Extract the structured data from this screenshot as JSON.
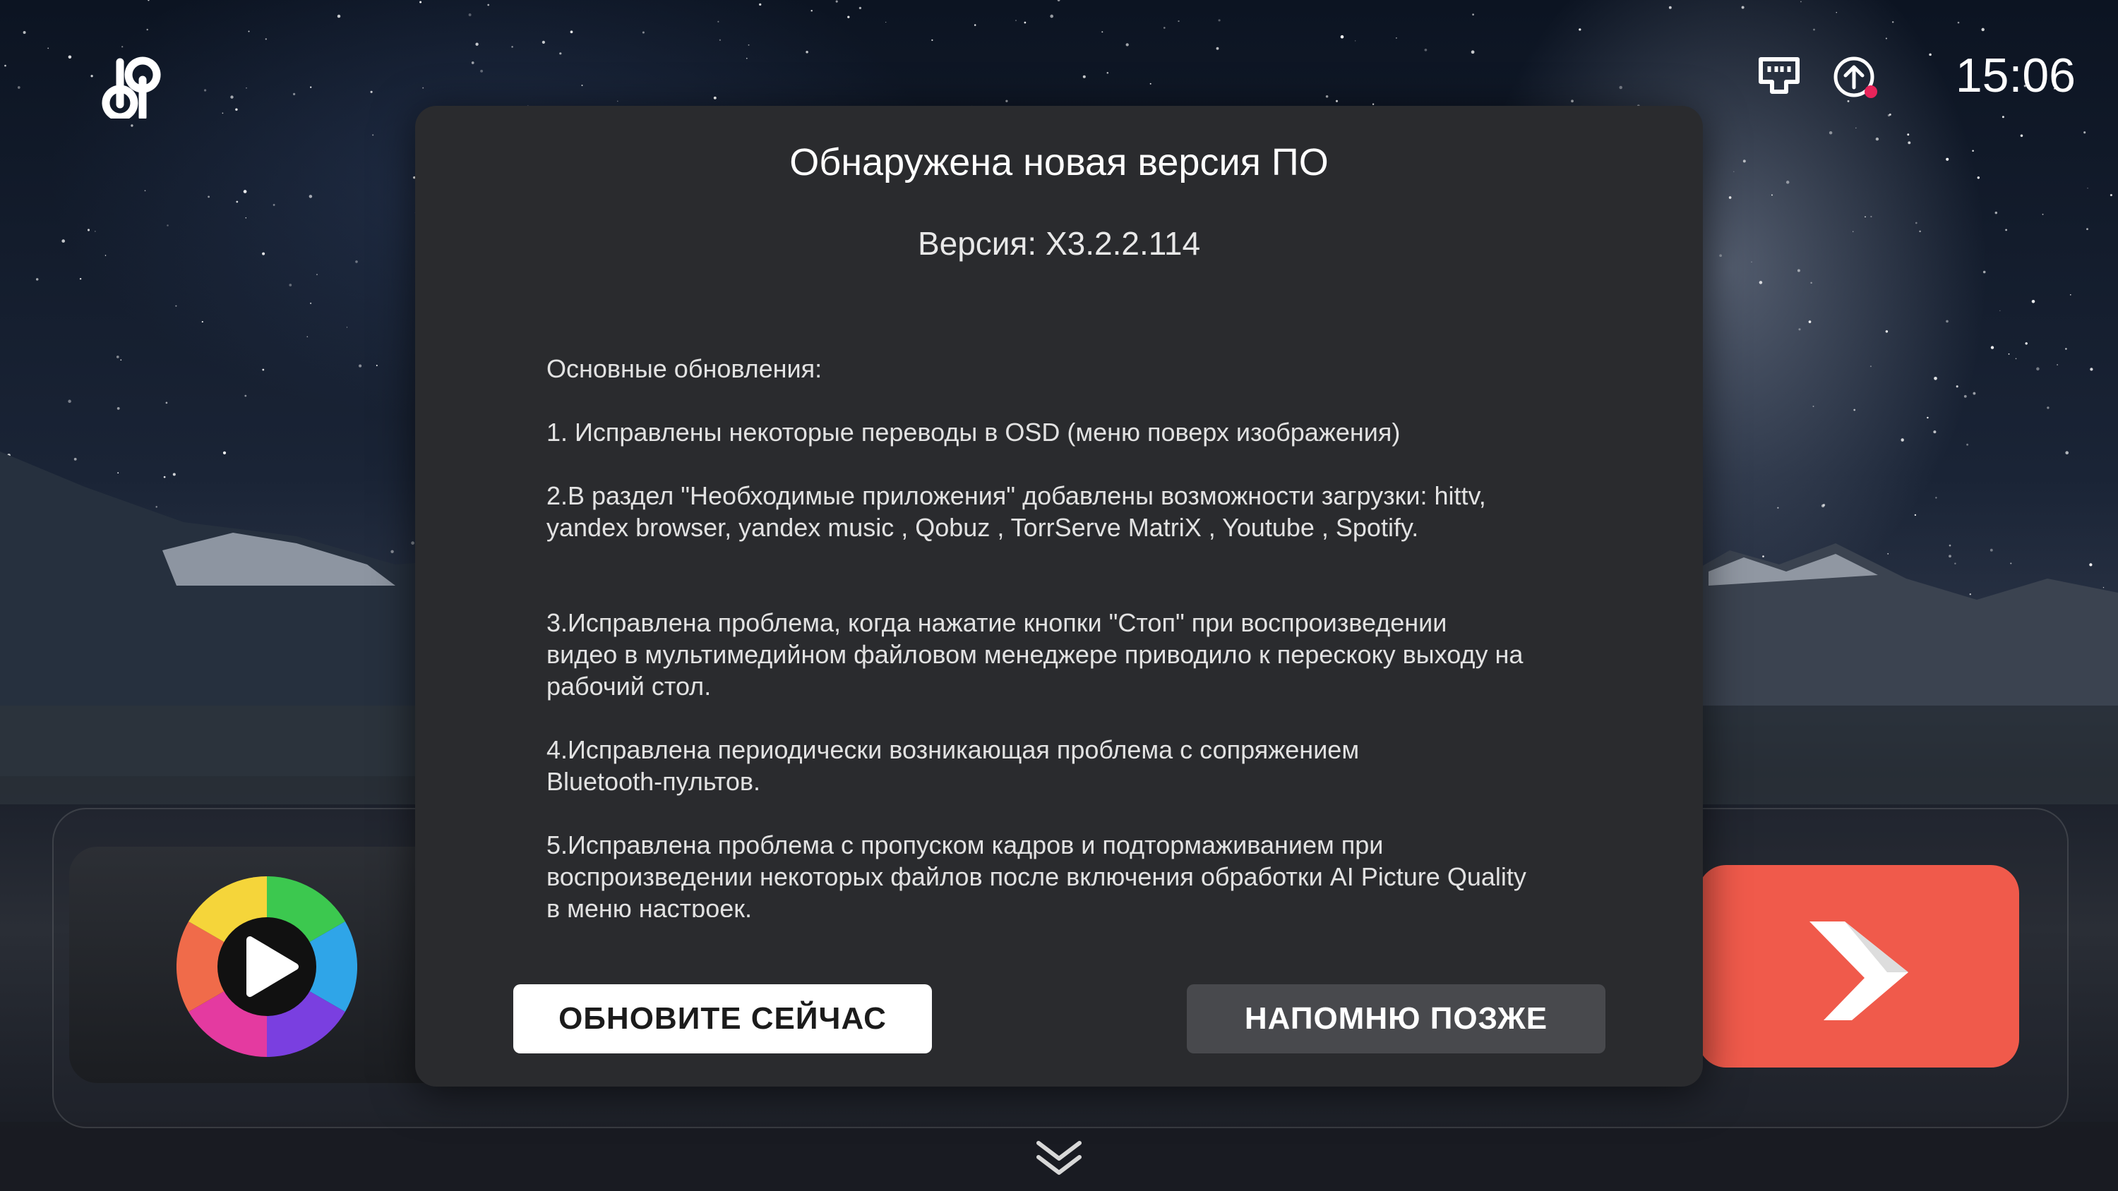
{
  "status_bar": {
    "time": "15:06",
    "logo": "dp-logo",
    "icons": [
      "ethernet-icon",
      "update-available-icon"
    ],
    "notification_dot_color": "#e8245a"
  },
  "dialog": {
    "title": "Обнаружена новая версия ПО",
    "version": "Версия: X3.2.2.114",
    "notes": [
      "Основные обновления:",
      "1. Исправлены некоторые переводы в OSD (меню поверх изображения)",
      "2.В раздел \"Необходимые приложения\" добавлены возможности загрузки: hittv,\nyandex browser, yandex music , Qobuz , TorrServe MatriX , Youtube , Spotify.",
      "3.Исправлена проблема, когда нажатие кнопки \"Стоп\" при воспроизведении\nвидео в мультимедийном файловом менеджере приводило к перескоку выходу на\nрабочий стол.",
      "4.Исправлена периодически возникающая проблема с сопряжением\nBluetooth-пультов.",
      "5.Исправлена проблема с пропуском кадров и подтормаживанием при\nвоспроизведении некоторых файлов после включения обработки AI Picture Quality\nв меню настроек."
    ],
    "buttons": {
      "update_now": "ОБНОВИТЕ СЕЙЧАС",
      "remind_later": "НАПОМНЮ ПОЗЖЕ"
    }
  },
  "apps": {
    "left_tile": "media-player-icon",
    "right_tile": "red-arrow-app-icon",
    "right_tile_color": "#f05a4b"
  },
  "footer": {
    "icon": "chevron-double-down-icon"
  }
}
